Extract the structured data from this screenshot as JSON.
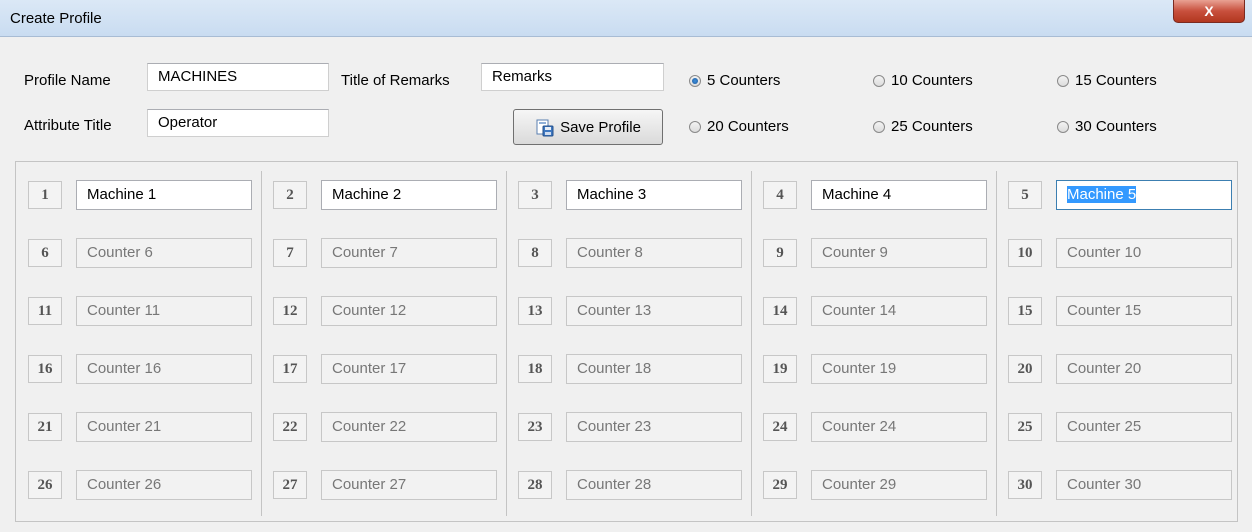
{
  "window": {
    "title": "Create Profile",
    "close_label": "X"
  },
  "form": {
    "profile_name_label": "Profile Name",
    "profile_name_value": "MACHINES",
    "remarks_label": "Title of Remarks",
    "remarks_value": "Remarks",
    "attribute_label": "Attribute Title",
    "attribute_value": "Operator",
    "save_label": "Save Profile"
  },
  "counter_options": [
    {
      "label": "5 Counters",
      "selected": true
    },
    {
      "label": "10 Counters",
      "selected": false
    },
    {
      "label": "15 Counters",
      "selected": false
    },
    {
      "label": "20 Counters",
      "selected": false
    },
    {
      "label": "25 Counters",
      "selected": false
    },
    {
      "label": "30 Counters",
      "selected": false
    }
  ],
  "counters": [
    {
      "number": "1",
      "name": "Machine 1",
      "active": true
    },
    {
      "number": "2",
      "name": "Machine 2",
      "active": true
    },
    {
      "number": "3",
      "name": "Machine 3",
      "active": true
    },
    {
      "number": "4",
      "name": "Machine 4",
      "active": true
    },
    {
      "number": "5",
      "name": "Machine 5",
      "active": true,
      "focused": true
    },
    {
      "number": "6",
      "name": "Counter 6",
      "active": false
    },
    {
      "number": "7",
      "name": "Counter 7",
      "active": false
    },
    {
      "number": "8",
      "name": "Counter 8",
      "active": false
    },
    {
      "number": "9",
      "name": "Counter 9",
      "active": false
    },
    {
      "number": "10",
      "name": "Counter 10",
      "active": false
    },
    {
      "number": "11",
      "name": "Counter 11",
      "active": false
    },
    {
      "number": "12",
      "name": "Counter 12",
      "active": false
    },
    {
      "number": "13",
      "name": "Counter 13",
      "active": false
    },
    {
      "number": "14",
      "name": "Counter 14",
      "active": false
    },
    {
      "number": "15",
      "name": "Counter 15",
      "active": false
    },
    {
      "number": "16",
      "name": "Counter 16",
      "active": false
    },
    {
      "number": "17",
      "name": "Counter 17",
      "active": false
    },
    {
      "number": "18",
      "name": "Counter 18",
      "active": false
    },
    {
      "number": "19",
      "name": "Counter 19",
      "active": false
    },
    {
      "number": "20",
      "name": "Counter 20",
      "active": false
    },
    {
      "number": "21",
      "name": "Counter 21",
      "active": false
    },
    {
      "number": "22",
      "name": "Counter 22",
      "active": false
    },
    {
      "number": "23",
      "name": "Counter 23",
      "active": false
    },
    {
      "number": "24",
      "name": "Counter 24",
      "active": false
    },
    {
      "number": "25",
      "name": "Counter 25",
      "active": false
    },
    {
      "number": "26",
      "name": "Counter 26",
      "active": false
    },
    {
      "number": "27",
      "name": "Counter 27",
      "active": false
    },
    {
      "number": "28",
      "name": "Counter 28",
      "active": false
    },
    {
      "number": "29",
      "name": "Counter 29",
      "active": false
    },
    {
      "number": "30",
      "name": "Counter 30",
      "active": false
    }
  ]
}
